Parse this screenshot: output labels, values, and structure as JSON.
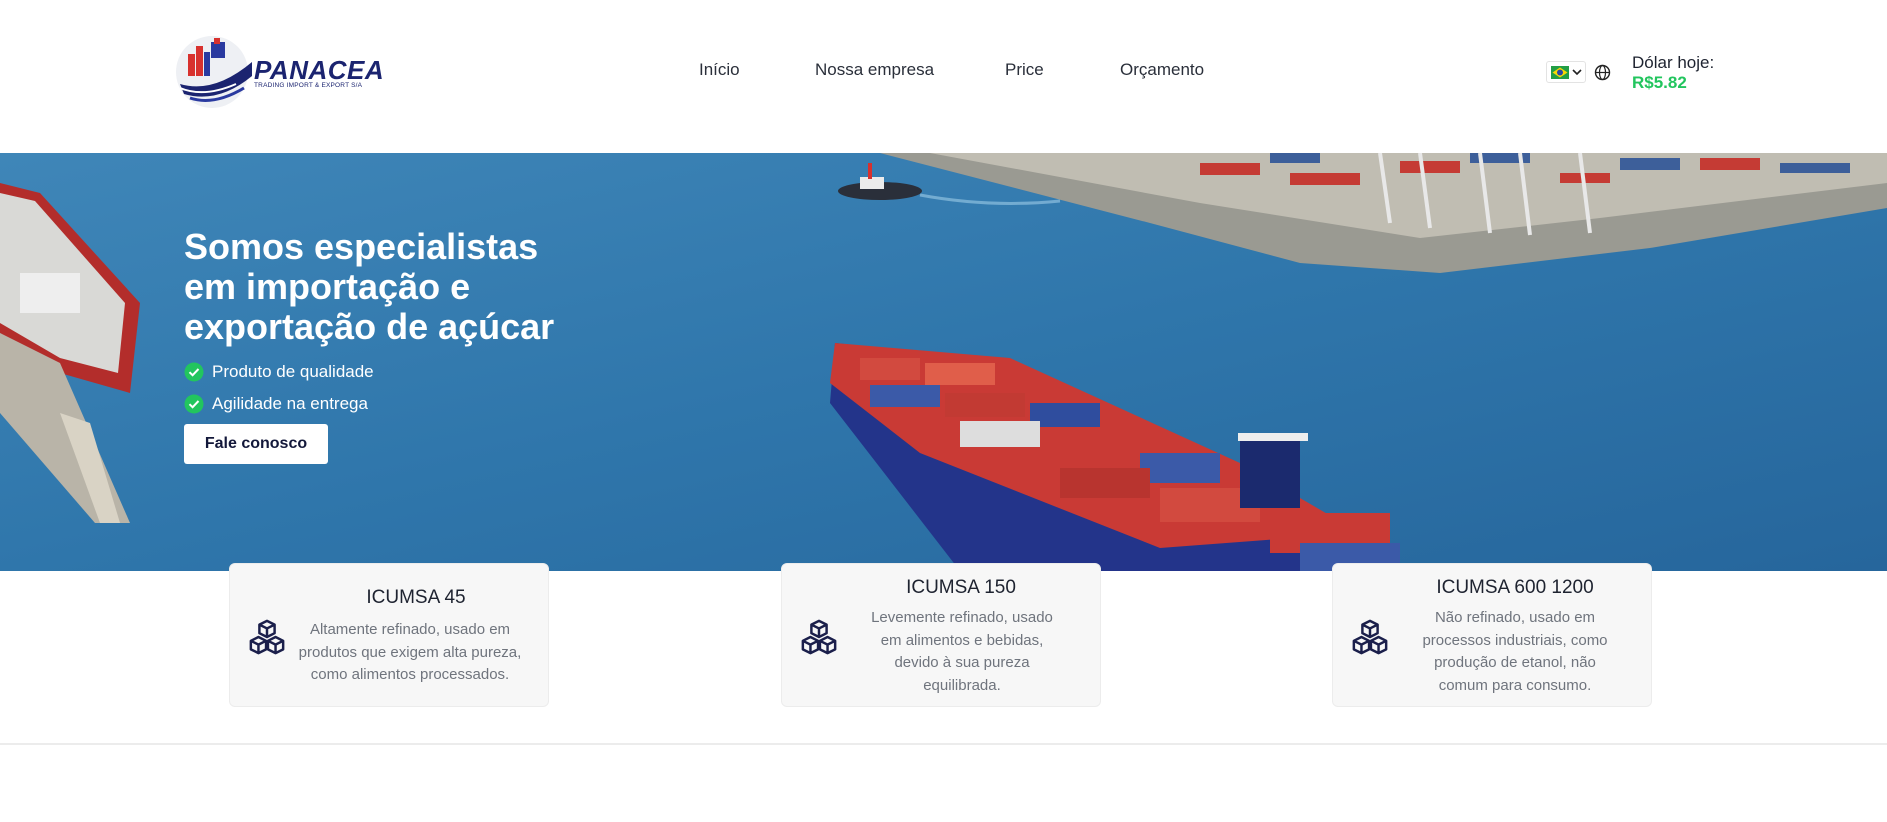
{
  "brand": {
    "name": "PANACEA",
    "tagline": "TRADING IMPORT & EXPORT S/A"
  },
  "nav": {
    "items": [
      {
        "label": "Início"
      },
      {
        "label": "Nossa empresa"
      },
      {
        "label": "Price"
      },
      {
        "label": "Orçamento"
      }
    ]
  },
  "language": {
    "flag": "brazil-flag-icon"
  },
  "dollar": {
    "label": "Dólar hoje:",
    "value": "R$5.82"
  },
  "hero": {
    "title": "Somos especialistas em importação e exportação de açúcar",
    "features": [
      {
        "text": "Produto de qualidade",
        "icon": "check-circle-icon"
      },
      {
        "text": "Agilidade na entrega",
        "icon": "check-circle-icon"
      }
    ],
    "cta_label": "Fale conosco"
  },
  "products": [
    {
      "title": "ICUMSA 45",
      "description": "Altamente refinado, usado em produtos que exigem alta pureza, como alimentos processados.",
      "icon": "cubes-icon"
    },
    {
      "title": "ICUMSA 150",
      "description": "Levemente refinado, usado em alimentos e bebidas, devido à sua pureza equilibrada.",
      "icon": "cubes-icon"
    },
    {
      "title": "ICUMSA 600 1200",
      "description": "Não refinado, usado em processos industriais, como produção de etanol, não comum para consumo.",
      "icon": "cubes-icon"
    }
  ],
  "colors": {
    "brand_navy": "#1b2470",
    "accent_green": "#22c55e",
    "sea_blue": "#3a82b5",
    "card_bg": "#f7f7f7"
  }
}
